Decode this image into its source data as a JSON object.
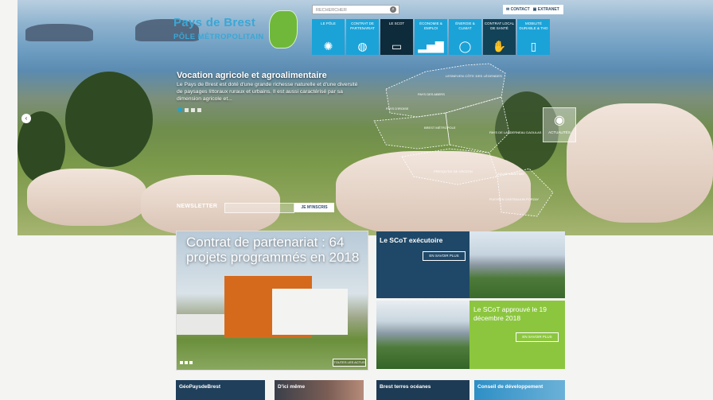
{
  "header": {
    "logo_line1": "Pays de Brest",
    "logo_line2": "PÔLE MÉTROPOLITAIN",
    "search_placeholder": "RECHERCHER",
    "contact_label": "CONTACT",
    "extranet_label": "EXTRANET"
  },
  "nav": [
    {
      "label": "LE PÔLE",
      "icon": "network-icon"
    },
    {
      "label": "CONTRAT DE PARTENARIAT",
      "icon": "globe-icon"
    },
    {
      "label": "LE SCOT",
      "icon": "screen-icon"
    },
    {
      "label": "ÉCONOMIE & EMPLOI",
      "icon": "bar-chart-icon"
    },
    {
      "label": "ÉNERGIE & CLIMAT",
      "icon": "lightbulb-icon"
    },
    {
      "label": "CONTRAT LOCAL DE SANTÉ",
      "icon": "handshake-icon"
    },
    {
      "label": "MOBILITÉ DURABLE & THD",
      "icon": "phone-icon"
    }
  ],
  "hero": {
    "headline": "Vocation agricole et agroalimentaire",
    "description": "Le Pays de Brest est doté d'une grande richesse naturelle et d'une diversité de paysages littoraux ruraux et urbains. Il est aussi caractérisé par sa dimension agricole et...",
    "map_labels": [
      "LESNEVEN CÔTE DES LÉGENDES",
      "PAYS DES ABERS",
      "PAYS D'IROISE",
      "BREST MÉTROPOLE",
      "PAYS DE LANDERNEAU DAOULAS",
      "PRESQU'ÎLE DE CROZON",
      "PLEYBEN CHÂTEAULIN PORZAY",
      "AULNE MARITIME"
    ],
    "actu_label": "ACTUALITÉS",
    "newsletter_label": "NEWSLETTER",
    "newsletter_button": "JE M'INSCRIS"
  },
  "featured": {
    "title": "Contrat de partenariat : 64 projets programmés en 2018",
    "button": "TOUTES LES ACTUS"
  },
  "panels": {
    "scot_exec_title": "Le SCoT exécutoire",
    "scot_exec_button": "EN SAVOIR PLUS",
    "scot_approved_title": "Le SCoT approuvé le 19 décembre 2018",
    "scot_approved_button": "EN SAVOIR PLUS"
  },
  "bottom": [
    "GéoPaysdeBrest",
    "D'ici même",
    "Brest terres océanes",
    "Conseil de développement"
  ],
  "colors": {
    "accent": "#1ba3d8",
    "dark_tile": "#0e2b3b",
    "green": "#8cc63f",
    "navy": "#1f4868"
  }
}
